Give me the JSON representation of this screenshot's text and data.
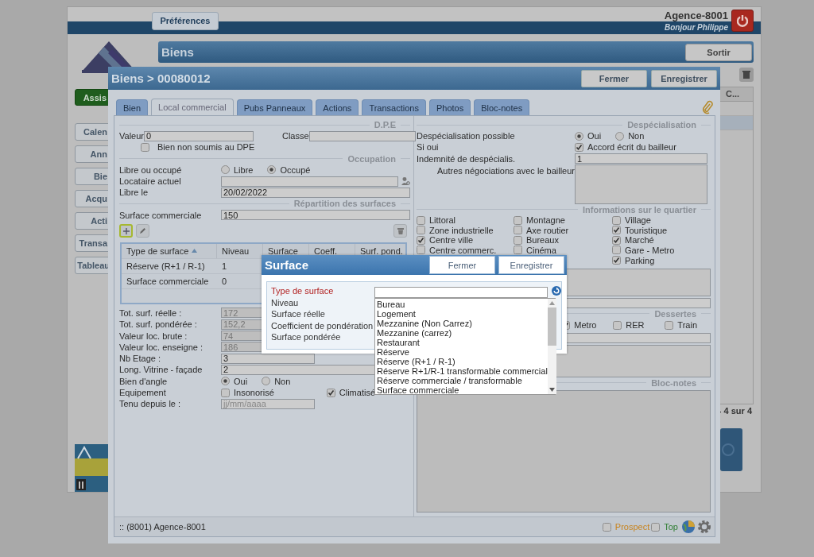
{
  "app": {
    "preferences": "Préférences",
    "agency": "Agence-8001",
    "greeting": "Bonjour Philippe",
    "title": "Biens",
    "exit": "Sortir",
    "assist": "Assis",
    "nav": [
      "Calen",
      "Ann",
      "Bie",
      "Acqu",
      "Acti",
      "Transa",
      "Tableau"
    ],
    "column_header": "C...",
    "pagination": "- 4 sur 4"
  },
  "dialog": {
    "title": "Biens > 00080012",
    "buttons": [
      "Fermer",
      "Enregistrer"
    ],
    "tabs": [
      {
        "label": "Bien",
        "selected": false
      },
      {
        "label": "Local commercial",
        "selected": true
      },
      {
        "label": "Pubs Panneaux",
        "selected": false
      },
      {
        "label": "Actions",
        "selected": false
      },
      {
        "label": "Transactions",
        "selected": false
      },
      {
        "label": "Photos",
        "selected": false
      },
      {
        "label": "Bloc-notes",
        "selected": false
      }
    ]
  },
  "dpe": {
    "title": "D.P.E",
    "value_label": "Valeur",
    "value": "0",
    "class_label": "Classe",
    "exempt": {
      "label": "Bien non soumis au DPE",
      "checked": false
    }
  },
  "occupation": {
    "title": "Occupation",
    "status": {
      "label": "Libre ou occupé",
      "options": [
        {
          "label": "Libre",
          "selected": false
        },
        {
          "label": "Occupé",
          "selected": true
        }
      ]
    },
    "tenant_label": "Locataire actuel",
    "free_from": {
      "label": "Libre le",
      "value": "20/02/2022"
    }
  },
  "surfaces": {
    "title": "Répartition des surfaces",
    "commercial": {
      "label": "Surface commerciale",
      "value": "150"
    },
    "table": {
      "columns": [
        {
          "label": "Type de surface",
          "sorted": true
        },
        {
          "label": "Niveau",
          "sorted": false
        },
        {
          "label": "Surface",
          "sorted": false
        },
        {
          "label": "Coeff.",
          "sorted": false
        },
        {
          "label": "Surf. pond.",
          "sorted": false
        }
      ],
      "rows": [
        [
          "Réserve (R+1 / R-1)",
          "1"
        ],
        [
          "Surface commerciale",
          "0"
        ]
      ]
    }
  },
  "totals": [
    {
      "label": "Tot. surf. réelle :",
      "value": "172",
      "disabled": true
    },
    {
      "label": "Tot. surf. pondérée :",
      "value": "152,2",
      "disabled": true
    },
    {
      "label": "Valeur loc. brute :",
      "value": "74",
      "disabled": true
    },
    {
      "label": "Valeur loc. enseigne :",
      "value": "186",
      "disabled": true
    }
  ],
  "details": {
    "floors": {
      "label": "Nb Etage :",
      "value": "3"
    },
    "frontage": {
      "label": "Long. Vitrine - façade",
      "value": "2"
    },
    "corner": {
      "label": "Bien d'angle",
      "options": [
        {
          "label": "Oui",
          "selected": true
        },
        {
          "label": "Non",
          "selected": false
        }
      ]
    },
    "equipment": {
      "label": "Equipement",
      "options": [
        {
          "label": "Insonorisé",
          "checked": false
        },
        {
          "label": "Climatisé",
          "checked": true
        }
      ]
    },
    "held_since": {
      "label": "Tenu depuis le :",
      "placeholder": "jj/mm/aaaa"
    }
  },
  "despecialisation": {
    "title": "Despécialisation",
    "possible": {
      "label": "Despécialisation possible",
      "options": [
        {
          "label": "Oui",
          "selected": true
        },
        {
          "label": "Non",
          "selected": false
        }
      ]
    },
    "condition": {
      "label": "Si oui",
      "checkbox": {
        "label": "Accord écrit du bailleur",
        "checked": true
      }
    },
    "indemnity": {
      "label": "Indemnité de despécialis.",
      "value": "1"
    },
    "negotiations_label": "Autres négociations avec le bailleur"
  },
  "quartier": {
    "title": "Informations sur le quartier",
    "columns": [
      [
        {
          "label": "Littoral",
          "checked": false
        },
        {
          "label": "Zone industrielle",
          "checked": false
        },
        {
          "label": "Centre ville",
          "checked": true
        },
        {
          "label": "Centre commerc.",
          "checked": false
        }
      ],
      [
        {
          "label": "Montagne",
          "checked": false
        },
        {
          "label": "Axe routier",
          "checked": false
        },
        {
          "label": "Bureaux",
          "checked": false
        },
        {
          "label": "Cinéma",
          "checked": false
        }
      ],
      [
        {
          "label": "Village",
          "checked": false
        },
        {
          "label": "Touristique",
          "checked": true
        },
        {
          "label": "Marché",
          "checked": true
        },
        {
          "label": "Gare - Metro",
          "checked": false
        },
        {
          "label": "Parking",
          "checked": true
        }
      ]
    ]
  },
  "dessertes": {
    "title": "Dessertes",
    "options": [
      {
        "label": "Metro",
        "checked": true
      },
      {
        "label": "RER",
        "checked": false
      },
      {
        "label": "Train",
        "checked": false
      }
    ]
  },
  "notes": {
    "title": "Bloc-notes"
  },
  "footer": {
    "agency": ":: (8001) Agence-8001",
    "flags": [
      {
        "label": "Prospect",
        "checked": false,
        "color": "#c8841e"
      },
      {
        "label": "Top",
        "checked": false,
        "color": "#2e7d32"
      }
    ]
  },
  "popup": {
    "title": "Surface",
    "buttons": [
      "Fermer",
      "Enregistrer"
    ],
    "fields": [
      {
        "label": "Type de surface",
        "required": true
      },
      {
        "label": "Niveau",
        "required": false
      },
      {
        "label": "Surface réelle",
        "required": false
      },
      {
        "label": "Coefficient de pondération",
        "required": false
      },
      {
        "label": "Surface pondérée",
        "required": false
      }
    ],
    "options": [
      "Bureau",
      "Logement",
      "Mezzanine (Non Carrez)",
      "Mezzanine (carrez)",
      "Restaurant",
      "Réserve",
      "Réserve (R+1 / R-1)",
      "Réserve R+1/R-1 transformable commercial",
      "Réserve commerciale / transformable",
      "Surface commerciale"
    ]
  }
}
